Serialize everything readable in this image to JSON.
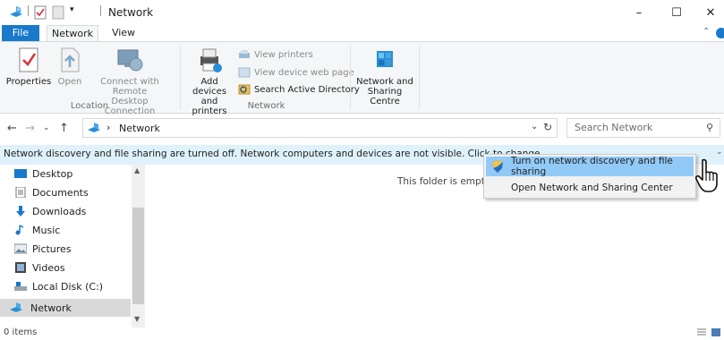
{
  "window": {
    "title": "Network",
    "minimize": "–",
    "maximize": "☐",
    "close": "✕"
  },
  "ribbon_tabs": [
    "File",
    "Network",
    "View"
  ],
  "ribbon": {
    "location": {
      "properties": "Properties",
      "open": "Open",
      "connect_remote_line1": "Connect with Remote",
      "connect_remote_line2": "Desktop Connection",
      "label": "Location"
    },
    "network": {
      "add_devices_line1": "Add devices",
      "add_devices_line2": "and printers",
      "view_printers": "View printers",
      "view_device_web_page": "View device web page",
      "search_active_directory": "Search Active Directory",
      "label": "Network"
    },
    "sharing": {
      "line1": "Network and",
      "line2": "Sharing Centre"
    }
  },
  "address": {
    "path": "Network",
    "separator": "›",
    "search_placeholder": "Search Network"
  },
  "infobar": {
    "text": "Network discovery and file sharing are turned off. Network computers and devices are not visible. Click to change..."
  },
  "nav_pane": {
    "items": [
      "Desktop",
      "Documents",
      "Downloads",
      "Music",
      "Pictures",
      "Videos",
      "Local Disk (C:)",
      "Network"
    ]
  },
  "content": {
    "empty_message": "This folder is empty."
  },
  "context_menu": {
    "items": [
      "Turn on network discovery and file sharing",
      "Open Network and Sharing Center"
    ]
  },
  "status": {
    "items_count": "0 items"
  },
  "colors": {
    "accent": "#1979ca",
    "infobar": "#dff2fc",
    "menu_highlight": "#91c9f7"
  }
}
